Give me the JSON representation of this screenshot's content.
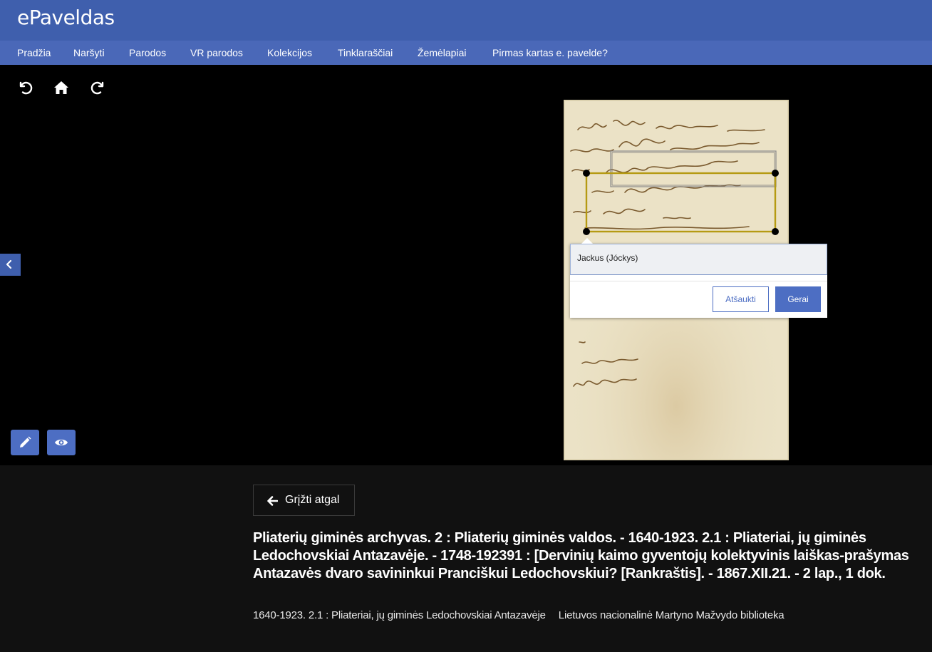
{
  "header": {
    "logo": "ePaveldas"
  },
  "nav": {
    "items": [
      {
        "label": "Pradžia"
      },
      {
        "label": "Naršyti"
      },
      {
        "label": "Parodos"
      },
      {
        "label": "VR parodos"
      },
      {
        "label": "Kolekcijos"
      },
      {
        "label": "Tinklaraščiai"
      },
      {
        "label": "Žemėlapiai"
      },
      {
        "label": "Pirmas kartas e. pavelde?"
      }
    ]
  },
  "viewer": {
    "toolbar": {
      "rotate_left_icon": "rotate-left-icon",
      "home_icon": "home-icon",
      "rotate_right_icon": "rotate-right-icon"
    },
    "annotation_editor": {
      "value": "Jackus (Jóckys)",
      "cancel_label": "Atšaukti",
      "ok_label": "Gerai"
    }
  },
  "back": {
    "label": "Grįžti atgal"
  },
  "record": {
    "title": "Pliaterių giminės archyvas. 2 : Pliaterių giminės valdos. - 1640-1923. 2.1 : Pliateriai, jų giminės Ledochovskiai Antazavėje. - 1748-192391 : [Dervinių kaimo gyventojų kolektyvinis laiškas-prašymas Antazavės dvaro savininkui Pranciškui Ledochovskiui? [Rankraštis]. - 1867.XII.21. - 2 lap., 1 dok.",
    "collection": "1640-1923. 2.1 : Pliateriai, jų giminės Ledochovskiai Antazavėje",
    "institution": "Lietuvos nacionalinė Martyno Mažvydo biblioteka"
  },
  "colors": {
    "header": "#3f5fad",
    "nav": "#4a68b8",
    "accent": "#4d6ec3",
    "annotation_box": "#b59a12"
  }
}
